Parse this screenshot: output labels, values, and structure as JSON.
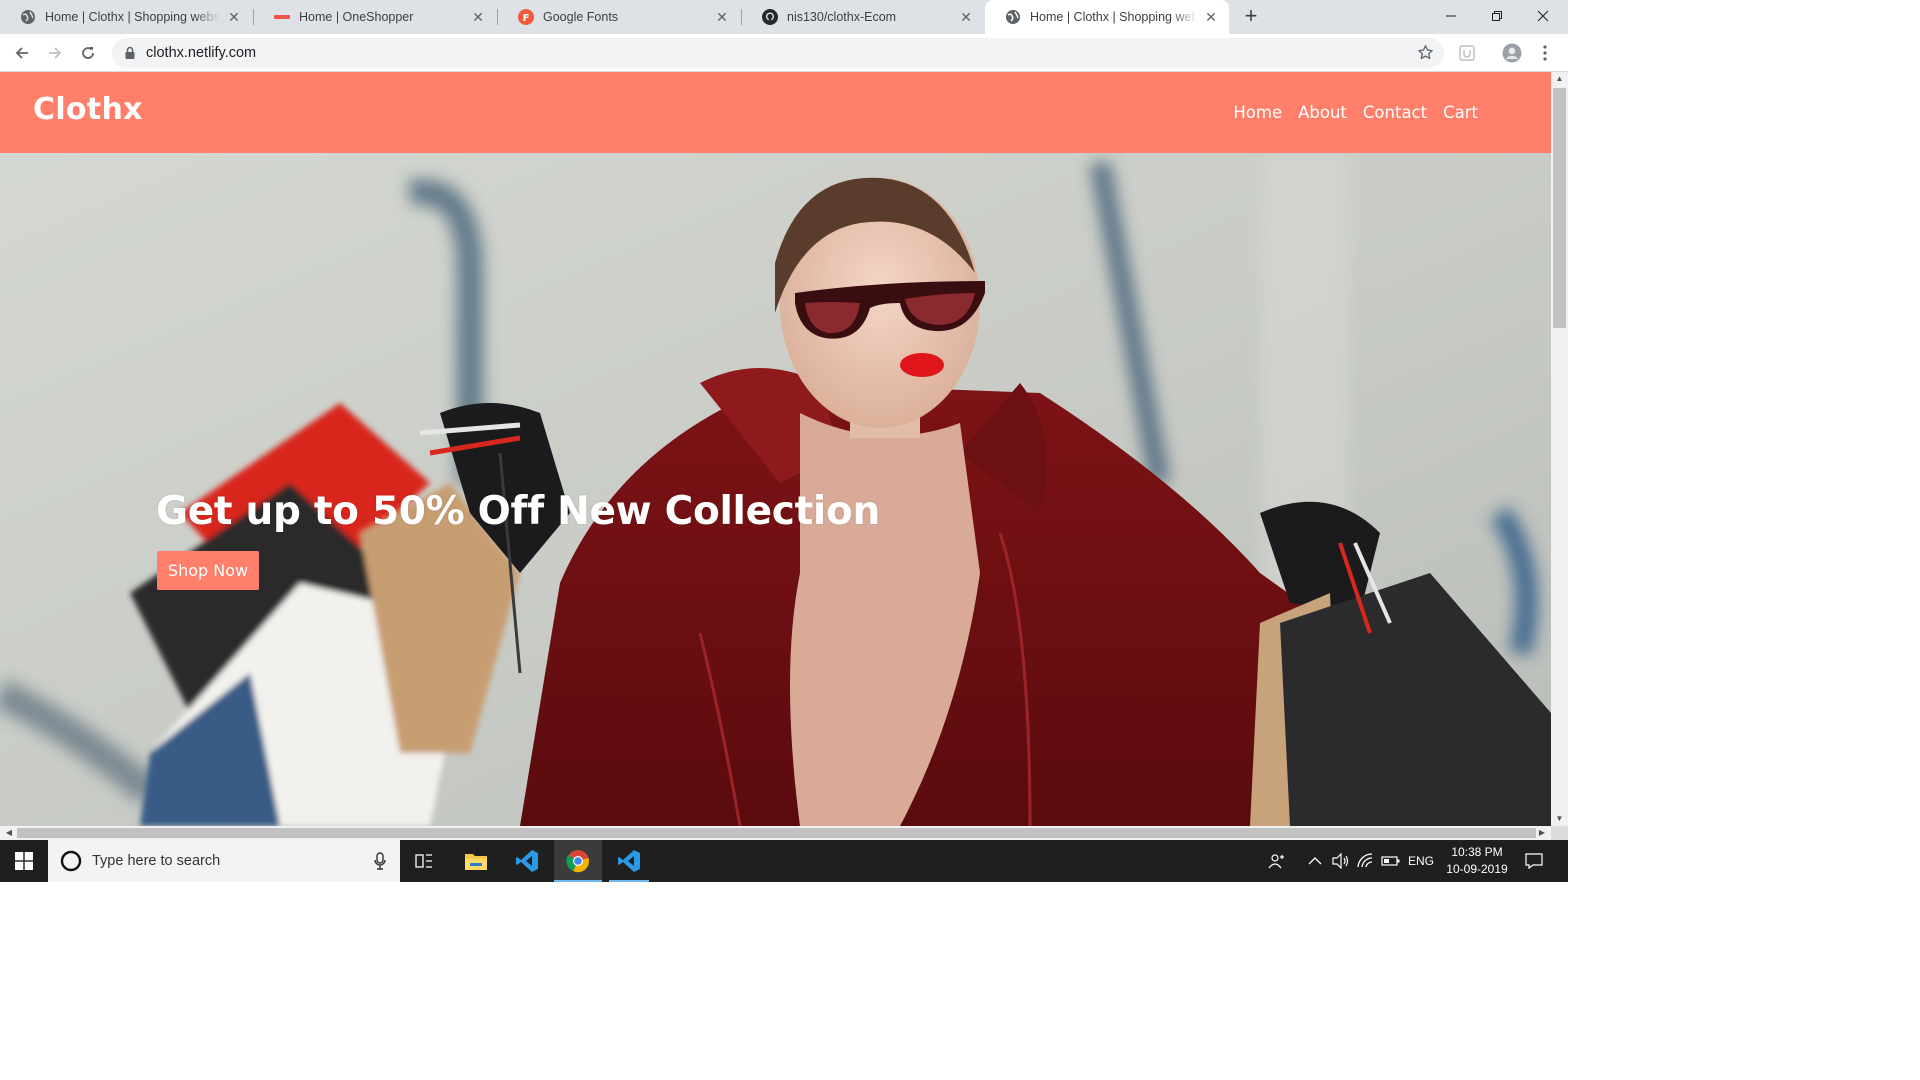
{
  "browser": {
    "tabs": [
      {
        "title": "Home | Clothx | Shopping website",
        "favicon": "globe-icon",
        "active": false
      },
      {
        "title": "Home | OneShopper",
        "favicon": "red-dash-icon",
        "active": false
      },
      {
        "title": "Google Fonts",
        "favicon": "google-fonts-icon",
        "active": false
      },
      {
        "title": "nis130/clothx-Ecom",
        "favicon": "github-icon",
        "active": false
      },
      {
        "title": "Home | Clothx | Shopping website",
        "favicon": "globe-icon",
        "active": true
      }
    ],
    "url": "clothx.netlify.com"
  },
  "site": {
    "brand": "Clothx",
    "nav": [
      "Home",
      "About",
      "Contact",
      "Cart"
    ],
    "hero": {
      "title": "Get up to 50% Off New Collection",
      "button": "Shop Now"
    }
  },
  "taskbar": {
    "search_placeholder": "Type here to search",
    "language": "ENG",
    "time": "10:38 PM",
    "date": "10-09-2019"
  },
  "colors": {
    "accent": "#ff7f6a",
    "taskbar": "#1f1f1f",
    "tabstrip": "#dee1e6"
  }
}
